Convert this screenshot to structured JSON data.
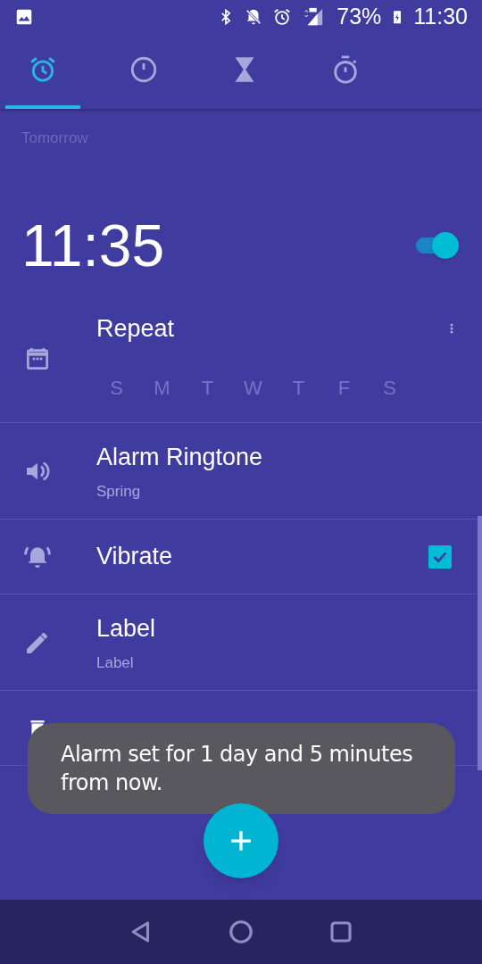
{
  "status_bar": {
    "battery": "73%",
    "time": "11:30"
  },
  "tabs": [
    {
      "kind": "alarm",
      "selected": true
    },
    {
      "kind": "clock",
      "selected": false
    },
    {
      "kind": "timer",
      "selected": false
    },
    {
      "kind": "stopwatch",
      "selected": false
    }
  ],
  "alarm": {
    "day_label": "Tomorrow",
    "time": "11:35",
    "enabled": true,
    "repeat": {
      "label": "Repeat",
      "days": [
        {
          "letter": "S",
          "selected": false
        },
        {
          "letter": "M",
          "selected": false
        },
        {
          "letter": "T",
          "selected": false
        },
        {
          "letter": "W",
          "selected": false
        },
        {
          "letter": "T",
          "selected": false
        },
        {
          "letter": "F",
          "selected": false
        },
        {
          "letter": "S",
          "selected": false
        }
      ]
    },
    "options": [
      {
        "kind": "ringtone",
        "title": "Alarm Ringtone",
        "subtitle": "Spring"
      },
      {
        "kind": "vibrate",
        "title": "Vibrate",
        "checked": true
      },
      {
        "kind": "label",
        "title": "Label",
        "subtitle": "Label"
      }
    ]
  },
  "toast": {
    "text": "Alarm set for 1 day and 5 minutes from now."
  }
}
